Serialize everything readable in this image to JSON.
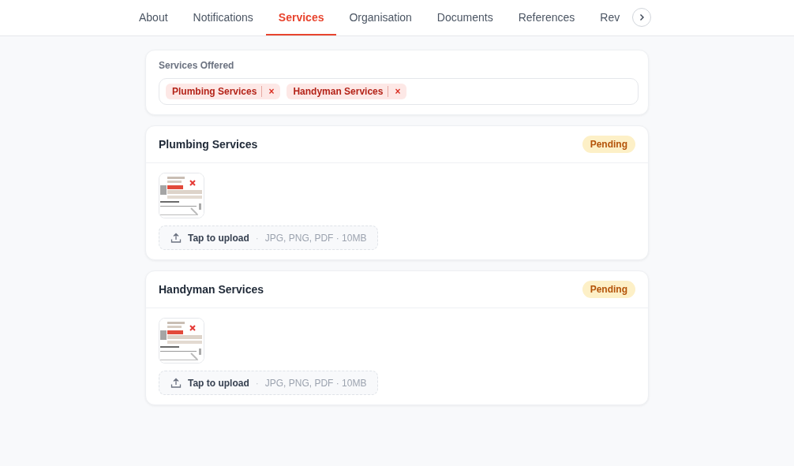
{
  "tabs": [
    {
      "label": "About",
      "selected": false
    },
    {
      "label": "Notifications",
      "selected": false
    },
    {
      "label": "Services",
      "selected": true
    },
    {
      "label": "Organisation",
      "selected": false
    },
    {
      "label": "Documents",
      "selected": false
    },
    {
      "label": "References",
      "selected": false
    },
    {
      "label": "Rev",
      "selected": false
    }
  ],
  "services_offered": {
    "label": "Services Offered",
    "chips": [
      {
        "label": "Plumbing Services",
        "remove": "×"
      },
      {
        "label": "Handyman Services",
        "remove": "×"
      }
    ]
  },
  "services": [
    {
      "title": "Plumbing Services",
      "status": {
        "label": "Pending",
        "kind": "warning"
      },
      "upload": {
        "label": "Tap to upload",
        "separator": "·",
        "hint": "JPG, PNG, PDF · 10MB"
      }
    },
    {
      "title": "Handyman Services",
      "status": {
        "label": "Pending",
        "kind": "warning"
      },
      "upload": {
        "label": "Tap to upload",
        "separator": "·",
        "hint": "JPG, PNG, PDF · 10MB"
      }
    }
  ]
}
